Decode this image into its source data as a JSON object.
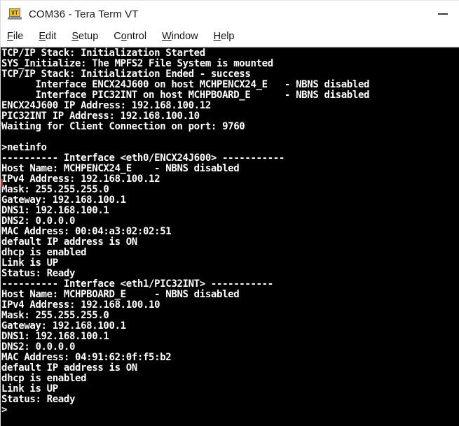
{
  "window": {
    "title": "COM36 - Tera Term VT",
    "icon": "teraterm-vt-laptop-icon",
    "minimize_label": "Minimize",
    "accent_icon_screen": "#f2c21b",
    "accent_icon_text": "#2b3a8f"
  },
  "menubar": {
    "items": [
      {
        "label": "File",
        "accel": "F",
        "before": "",
        "after": "ile"
      },
      {
        "label": "Edit",
        "accel": "E",
        "before": "",
        "after": "dit"
      },
      {
        "label": "Setup",
        "accel": "S",
        "before": "",
        "after": "etup"
      },
      {
        "label": "Control",
        "accel": "o",
        "before": "C",
        "after": "ntrol"
      },
      {
        "label": "Window",
        "accel": "W",
        "before": "",
        "after": "indow"
      },
      {
        "label": "Help",
        "accel": "H",
        "before": "",
        "after": "elp"
      }
    ]
  },
  "terminal": {
    "foreground": "#ffffff",
    "background": "#000000",
    "prompt": ">",
    "command": "netinfo",
    "lines": [
      "TCP/IP Stack: Initialization Started",
      "SYS_Initialize: The MPFS2 File System is mounted",
      "TCP/IP Stack: Initialization Ended - success",
      "      Interface ENCX24J600 on host MCHPENCX24_E   - NBNS disabled",
      "      Interface PIC32INT on host MCHPBOARD_E      - NBNS disabled",
      "ENCX24J600 IP Address: 192.168.100.12",
      "PIC32INT IP Address: 192.168.100.10",
      "Waiting for Client Connection on port: 9760",
      "",
      ">netinfo",
      "---------- Interface <eth0/ENCX24J600> -----------",
      "Host Name: MCHPENCX24_E    - NBNS disabled",
      "IPv4 Address: 192.168.100.12",
      "Mask: 255.255.255.0",
      "Gateway: 192.168.100.1",
      "DNS1: 192.168.100.1",
      "DNS2: 0.0.0.0",
      "MAC Address: 00:04:a3:02:02:51",
      "default IP address is ON",
      "dhcp is enabled",
      "Link is UP",
      "Status: Ready",
      "---------- Interface <eth1/PIC32INT> -----------",
      "Host Name: MCHPBOARD_E     - NBNS disabled",
      "IPv4 Address: 192.168.100.10",
      "Mask: 255.255.255.0",
      "Gateway: 192.168.100.1",
      "DNS1: 192.168.100.1",
      "DNS2: 0.0.0.0",
      "MAC Address: 04:91:62:0f:f5:b2",
      "default IP address is ON",
      "dhcp is enabled",
      "Link is UP",
      "Status: Ready",
      ">"
    ]
  },
  "network": {
    "interfaces": [
      {
        "name": "eth0/ENCX24J600",
        "host_name": "MCHPENCX24_E",
        "nbns": "NBNS disabled",
        "ipv4_address": "192.168.100.12",
        "mask": "255.255.255.0",
        "gateway": "192.168.100.1",
        "dns1": "192.168.100.1",
        "dns2": "0.0.0.0",
        "mac_address": "00:04:a3:02:02:51",
        "default_ip_address": "ON",
        "dhcp": "enabled",
        "link": "UP",
        "status": "Ready"
      },
      {
        "name": "eth1/PIC32INT",
        "host_name": "MCHPBOARD_E",
        "nbns": "NBNS disabled",
        "ipv4_address": "192.168.100.10",
        "mask": "255.255.255.0",
        "gateway": "192.168.100.1",
        "dns1": "192.168.100.1",
        "dns2": "0.0.0.0",
        "mac_address": "04:91:62:0f:f5:b2",
        "default_ip_address": "ON",
        "dhcp": "enabled",
        "link": "UP",
        "status": "Ready"
      }
    ],
    "listen_port": "9760"
  }
}
